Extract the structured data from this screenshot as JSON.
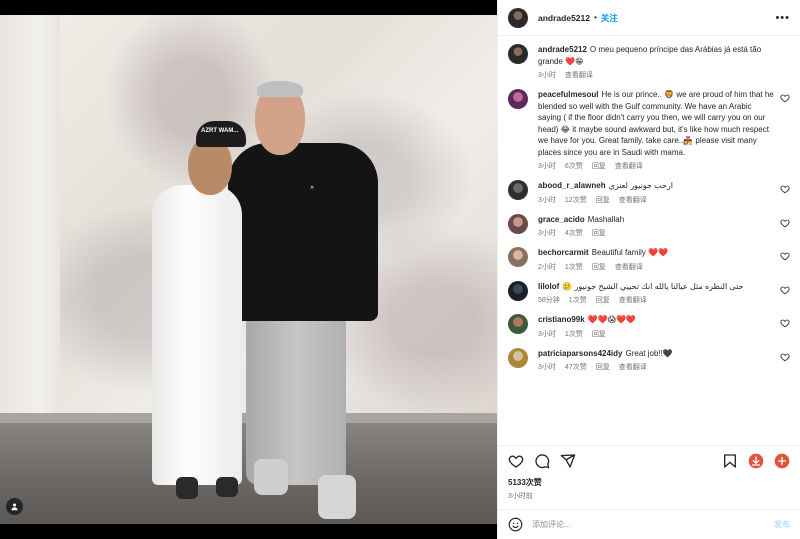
{
  "header": {
    "username": "andrade5212",
    "separator": "•",
    "follow_label": "关注",
    "more_icon": "more-horizontal-icon"
  },
  "caption": {
    "username": "andrade5212",
    "text": "O meu pequeno príncipe das Arábias já está tão grande ❤️😁",
    "time": "3小时",
    "translate": "查看翻译"
  },
  "comments": [
    {
      "username": "peacefulmesoul",
      "text": "He is our prince.. 🦁 we are proud of him that he blended so well with the Gulf community. We have an Arabic saying ( if the floor didn't carry you then, we will carry you on our head) 😂 it maybe sound awkward but, it's like how much respect we have for you. Great family. take care..👩‍❤️‍👨 please visit many places since you are in Saudi with mama.",
      "time": "3小时",
      "likes": "6次赞",
      "reply": "回复",
      "translate": "查看翻译"
    },
    {
      "username": "abood_r_alawneh",
      "text": "ارحب جونيور لعنزي",
      "time": "3小时",
      "likes": "12次赞",
      "reply": "回复",
      "translate": "查看翻译"
    },
    {
      "username": "grace_acido",
      "text": "Mashallah",
      "time": "3小时",
      "likes": "4次赞",
      "reply": "回复",
      "translate": ""
    },
    {
      "username": "bechorcarmit",
      "text": "Beautiful family ❤️❤️",
      "time": "2小时",
      "likes": "1次赞",
      "reply": "回复",
      "translate": "查看翻译"
    },
    {
      "username": "lilolof",
      "text": "حتى النظره مثل عيالنا يالله انك تحييي الشيخ جونيور 🥲",
      "time": "58分钟",
      "likes": "1次赞",
      "reply": "回复",
      "translate": "查看翻译"
    },
    {
      "username": "cristiano99k",
      "text": "❤️❤️😱❤️❤️",
      "time": "3小时",
      "likes": "1次赞",
      "reply": "回复",
      "translate": ""
    },
    {
      "username": "patriciaparsons424idy",
      "text": "Great job!!🖤",
      "time": "3小时",
      "likes": "47次赞",
      "reply": "回复",
      "translate": "查看翻译"
    }
  ],
  "photo": {
    "cap_text": "AZRT WAM..."
  },
  "actions": {
    "like_icon": "heart-icon",
    "comment_icon": "comment-icon",
    "share_icon": "send-icon",
    "save_icon": "bookmark-icon",
    "download_icon": "download-icon",
    "extra_icon": "red-circle-icon"
  },
  "likes": "5133次赞",
  "post_time": "3小时前",
  "add_comment": {
    "placeholder": "添加评论...",
    "post_label": "发布"
  },
  "colors": {
    "link_blue": "#0095f6",
    "post_disabled": "#b2dffc",
    "muted": "#737373",
    "heart_red": "#ed4956"
  }
}
